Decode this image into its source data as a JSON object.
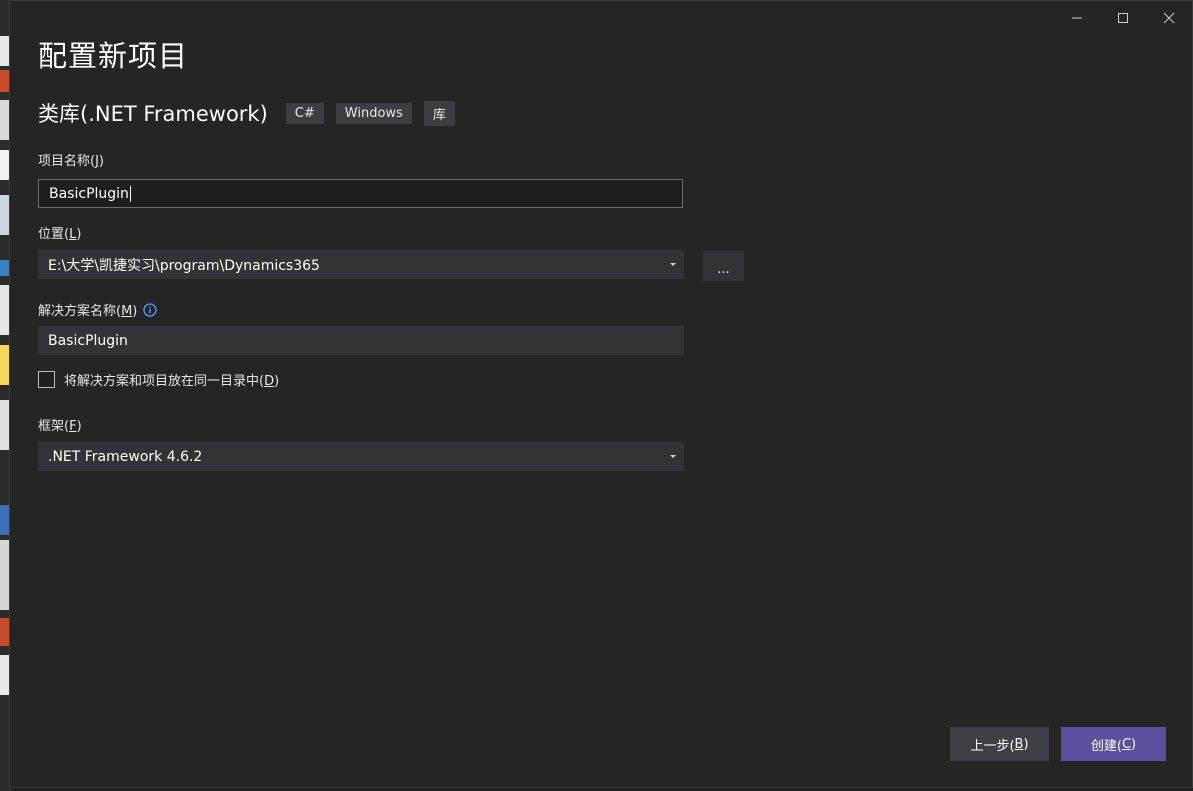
{
  "window": {
    "title": "配置新项目",
    "controls": [
      "minimize-icon",
      "maximize-icon",
      "close-icon"
    ]
  },
  "template": {
    "name": "类库(.NET Framework)",
    "tags": [
      "C#",
      "Windows",
      "库"
    ]
  },
  "project_name": {
    "label_text": "项目名称(",
    "label_key": "J",
    "label_end": ")",
    "value": "BasicPlugin"
  },
  "location": {
    "label_text": "位置(",
    "label_key": "L",
    "label_end": ")",
    "value": "E:\\大学\\凯捷实习\\program\\Dynamics365",
    "browse_label": "..."
  },
  "solution_name": {
    "label_text": "解决方案名称(",
    "label_key": "M",
    "label_end": ")",
    "value": "BasicPlugin"
  },
  "same_dir": {
    "label_text": "将解决方案和项目放在同一目录中(",
    "label_key": "D",
    "label_end": ")",
    "checked": false
  },
  "framework": {
    "label_text": "框架(",
    "label_key": "F",
    "label_end": ")",
    "value": ".NET Framework 4.6.2"
  },
  "buttons": {
    "back_text": "上一步(",
    "back_key": "B",
    "back_end": ")",
    "create_text": "创建(",
    "create_key": "C",
    "create_end": ")"
  },
  "colors": {
    "background": "#252526",
    "accent": "#5c4f9f",
    "field": "#333337"
  }
}
